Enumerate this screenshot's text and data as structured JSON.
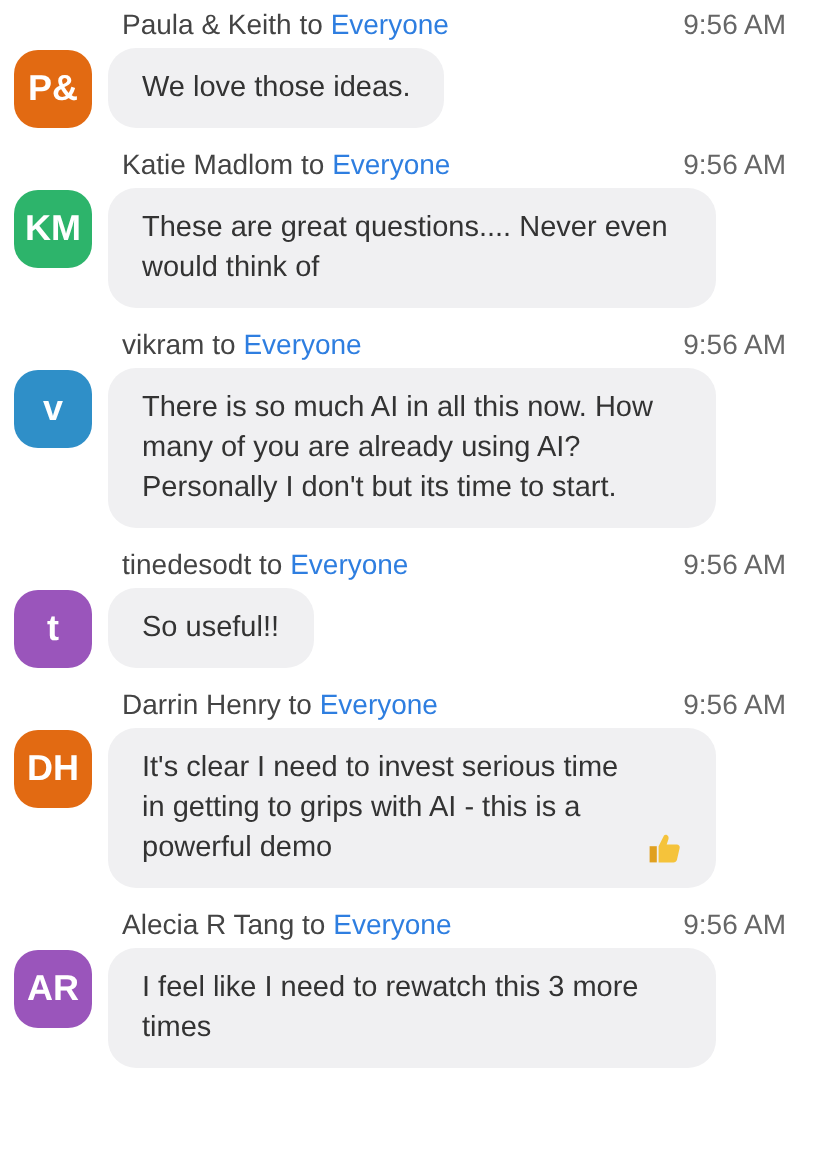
{
  "messages": [
    {
      "initials": "P&",
      "color": "#e26a12",
      "sender": "Paula & Keith",
      "to_word": "to",
      "recipient": "Everyone",
      "time": "9:56 AM",
      "text": "We love those ideas."
    },
    {
      "initials": "KM",
      "color": "#2db46b",
      "sender": "Katie Madlom",
      "to_word": "to",
      "recipient": "Everyone",
      "time": "9:56 AM",
      "text": "These are great questions.... Never even would think of"
    },
    {
      "initials": "v",
      "color": "#2f8fc8",
      "sender": "vikram",
      "to_word": "to",
      "recipient": "Everyone",
      "time": "9:56 AM",
      "text": "There is so much AI in all this now. How many of you are already using AI? Personally I don't but its time to start."
    },
    {
      "initials": "t",
      "color": "#9a55bb",
      "sender": "tinedesodt",
      "to_word": "to",
      "recipient": "Everyone",
      "time": "9:56 AM",
      "text": "So useful!!"
    },
    {
      "initials": "DH",
      "color": "#e26a12",
      "sender": "Darrin Henry",
      "to_word": "to",
      "recipient": "Everyone",
      "time": "9:56 AM",
      "text": "It's clear I need to invest serious time in getting to grips with AI - this is a powerful demo",
      "inline_icon": {
        "kind": "thumbs-up"
      }
    },
    {
      "initials": "AR",
      "color": "#9a55bb",
      "sender": "Alecia R Tang",
      "to_word": "to",
      "recipient": "Everyone",
      "time": "9:56 AM",
      "text": "I feel like I need to rewatch this 3 more times"
    }
  ]
}
